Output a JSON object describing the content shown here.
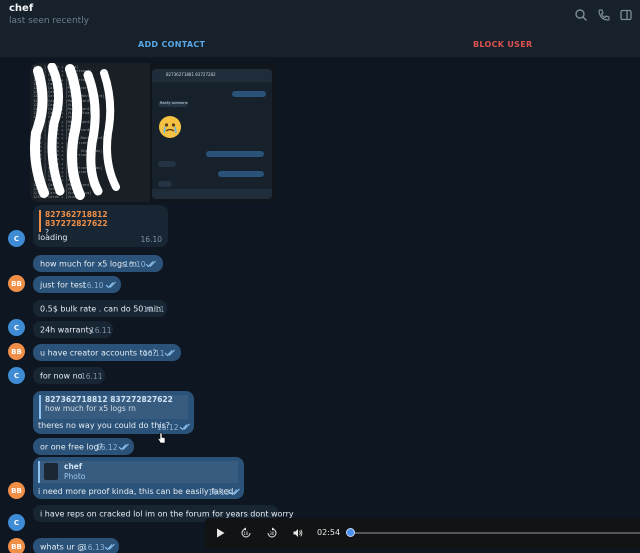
{
  "header": {
    "title": "chef",
    "status": "last seen recently",
    "icons": [
      "search-icon",
      "phone-icon",
      "sidebar-toggle-icon"
    ]
  },
  "actions": {
    "add_contact": "ADD CONTACT",
    "block_user": "BLOCK USER"
  },
  "colors": {
    "accent": "#5aa7e8",
    "danger": "#e05252",
    "incoming": "#182533",
    "outgoing": "#2b5278",
    "avatar_c": "#3e8bd6",
    "avatar_bb": "#ef8f48"
  },
  "photo_message": {
    "left_lines": "1234 ] Cards + [Visa]\n1234 ] Cards + [Mastercard]\n1234 ] Cards + [Visa]\n1234 ] Cards + [Mastercard]\n1234 ] Cards + [Visa]\n1234 ] Cards + [Mastercard]\n1234 ] Cards + [Visa]\n1234 ] Cards + [Visa, Mastercard]\n1234 ] Cards + [Mastercard]\n1234 ] Cards + [Visa]\n1234 ] Cards + [Mastercard]\n1234 ] Cards + [Visa, Visa]\n1234 ] Cards + [Visa]\n1234 ] Cards + [Mastercard]\n1234 ] Cards + [Visa]\n1234 ] Cards + [Mastercard]\n1234 ] Cards + [Visa]\n1234 ] Cards + [Visa, Mastercard]\n1234 ] Cards + [Mastercard]\n1234 ] Cards + [Visa]\n1234 ] Cards + [Visa, Visa, Mas]\n1234 ] Cards + [Mastercard]\n1234 ] Cards + [Visa]\n1234 ] Cards + [Visa]\n1234 ] Cards + [Mastercard, Mas]\n1234 ] Cards + [Mastercard]\n1234 ] Cards + [Visa]\n1234 ] Cards + [Visa]\n1234 ] Cards + [Mastercard]\n1234 ] Cards + [Visa]\n1234 ] Cards + [Visa, Visa]\n1234 ] Cards + [Visa]",
    "mini_chat_title": "82736271881 83727282",
    "mini_reply": "Really someone",
    "mini_time": "16.10"
  },
  "messages": [
    {
      "side": "in",
      "avatar": "C",
      "reply_name": "827362718812 837272827622",
      "reply_text": "?",
      "text": "loading",
      "time": "16.10"
    },
    {
      "side": "out",
      "text": "how much for x5 logs rn",
      "time": "16.10"
    },
    {
      "side": "out",
      "avatar": "BB",
      "text": "just for test",
      "time": "16.10"
    },
    {
      "side": "in",
      "text": "0.5$ bulk rate . can do 50 min",
      "time": "16.11"
    },
    {
      "side": "in",
      "avatar": "C",
      "text": "24h warranty",
      "time": "16.11"
    },
    {
      "side": "out",
      "avatar": "BB",
      "text": "u have creator accounts too?",
      "time": "16.11"
    },
    {
      "side": "in",
      "avatar": "C",
      "text": "for now no",
      "time": "16.11"
    },
    {
      "side": "out",
      "reply_name": "827362718812 837272827622",
      "reply_text": "how much for x5 logs rn",
      "text": "theres no way you could do this?",
      "time": "16.12"
    },
    {
      "side": "out",
      "text": "or one free log?",
      "time": "16.12"
    },
    {
      "side": "out",
      "avatar": "BB",
      "reply_name": "chef",
      "reply_text": "Photo",
      "text": "i need more proof kinda, this can be easily faked",
      "time": "16.13"
    },
    {
      "side": "in",
      "avatar": "C",
      "text": "i have reps on cracked lol im on the forum for years  dont worry",
      "time": ""
    },
    {
      "side": "out",
      "avatar": "BB",
      "text": "whats ur @",
      "time": "16.13"
    }
  ],
  "player": {
    "time": "02:54",
    "progress": 0.0,
    "icons": [
      "play-icon",
      "rewind-10-icon",
      "forward-30-icon",
      "volume-icon"
    ]
  }
}
